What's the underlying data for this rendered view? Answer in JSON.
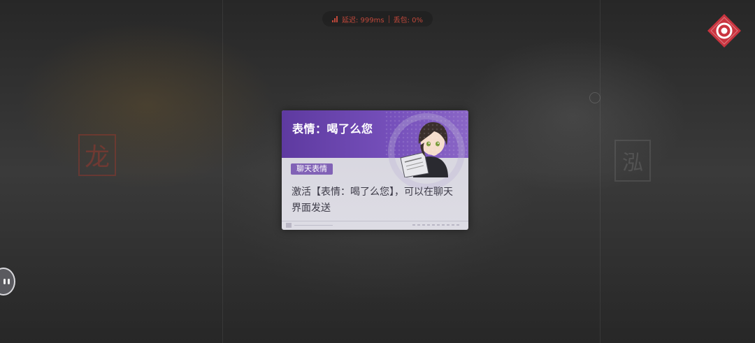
{
  "status_bar": {
    "latency_label": "延迟: 999ms",
    "packet_loss_label": "丢包: 0%",
    "signal_icon": "signal-bars-icon",
    "color": "#c0483a"
  },
  "corner_logo": {
    "icon": "red-diamond-logo-icon",
    "color": "#c9343f"
  },
  "card": {
    "title": "表情：喝了么您",
    "category_badge": "聊天表情",
    "description": "激活【表情：喝了么您】，可以在聊天界面发送",
    "header_color": "#6a45ad",
    "badge_color": "#8162b6"
  },
  "chat_button": {
    "icon": "chat-bubble-icon"
  }
}
